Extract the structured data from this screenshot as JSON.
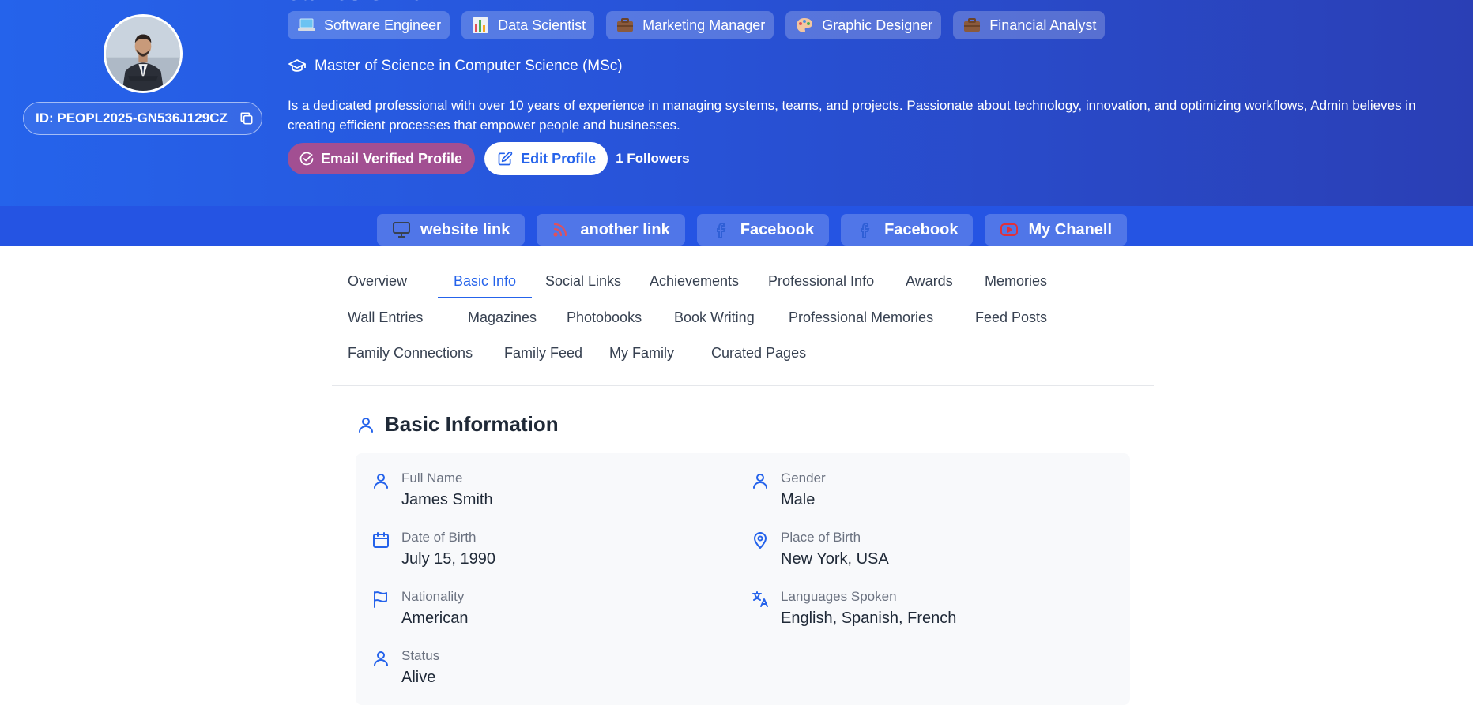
{
  "profile": {
    "name": "James Smith",
    "id_label": "ID: PEOPL2025-GN536J129CZ",
    "roles": [
      {
        "label": "Software Engineer",
        "icon": "laptop-icon"
      },
      {
        "label": "Data Scientist",
        "icon": "bar-chart-icon"
      },
      {
        "label": "Marketing Manager",
        "icon": "briefcase-icon"
      },
      {
        "label": "Graphic Designer",
        "icon": "palette-icon"
      },
      {
        "label": "Financial Analyst",
        "icon": "briefcase-icon"
      }
    ],
    "degree": "Master of Science in Computer Science (MSc)",
    "bio": "Is a dedicated professional with over 10 years of experience in managing systems, teams, and projects. Passionate about technology, innovation, and optimizing workflows, Admin believes in creating efficient processes that empower people and businesses.",
    "verified_label": "Email Verified Profile",
    "edit_label": "Edit Profile",
    "followers_label": "1 Followers"
  },
  "links": [
    {
      "label": "website link",
      "icon": "monitor-icon"
    },
    {
      "label": "another link",
      "icon": "rss-icon"
    },
    {
      "label": "Facebook",
      "icon": "facebook-icon"
    },
    {
      "label": "Facebook",
      "icon": "facebook-icon"
    },
    {
      "label": "My Chanell",
      "icon": "youtube-icon"
    }
  ],
  "tabs": [
    "Overview",
    "Basic Info",
    "Social Links",
    "Achievements",
    "Professional Info",
    "Awards",
    "Memories",
    "Wall Entries",
    "Magazines",
    "Photobooks",
    "Book Writing",
    "Professional Memories",
    "Feed Posts",
    "Family Connections",
    "Family Feed",
    "My Family",
    "Curated Pages"
  ],
  "active_tab": "Basic Info",
  "basic_info": {
    "title": "Basic Information",
    "fields": [
      {
        "label": "Full Name",
        "value": "James Smith",
        "icon": "user-icon"
      },
      {
        "label": "Gender",
        "value": "Male",
        "icon": "user-icon"
      },
      {
        "label": "Date of Birth",
        "value": "July 15, 1990",
        "icon": "calendar-icon"
      },
      {
        "label": "Place of Birth",
        "value": "New York, USA",
        "icon": "map-pin-icon"
      },
      {
        "label": "Nationality",
        "value": "American",
        "icon": "flag-icon"
      },
      {
        "label": "Languages Spoken",
        "value": "English, Spanish, French",
        "icon": "translate-icon"
      },
      {
        "label": "Status",
        "value": "Alive",
        "icon": "user-icon"
      }
    ]
  },
  "colors": {
    "hero_start": "#2563eb",
    "hero_end": "#2a3fb5",
    "accent": "#2563eb",
    "verified": "#a24f92"
  }
}
